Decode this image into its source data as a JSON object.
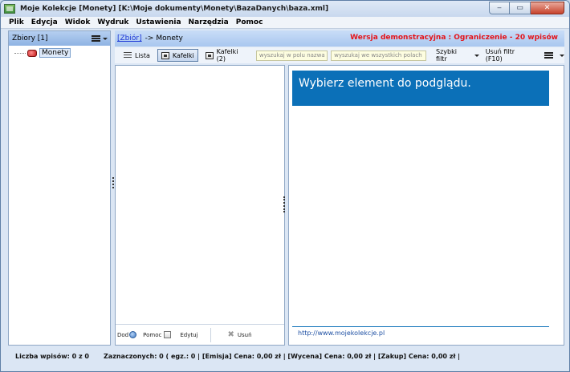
{
  "window": {
    "title": "Moje Kolekcje [Monety] [K:\\Moje dokumenty\\Monety\\BazaDanych\\baza.xml]",
    "controls": {
      "minimize": "‒",
      "maximize": "▭",
      "close": "✕"
    }
  },
  "menu": {
    "items": [
      "Plik",
      "Edycja",
      "Widok",
      "Wydruk",
      "Ustawienia",
      "Narzędzia",
      "Pomoc"
    ]
  },
  "sidebar": {
    "header": "Zbiory [1]",
    "tree": [
      {
        "label": "Monety"
      }
    ]
  },
  "breadcrumb": {
    "link": "[Zbiór]",
    "separator": "->",
    "current": "Monety",
    "demo_notice": "Wersja demonstracyjna : Ograniczenie - 20 wpisów"
  },
  "toolbar": {
    "view_list": "Lista",
    "view_tiles": "Kafelki",
    "view_tiles2": "Kafelki (2)",
    "search_name_placeholder": "wyszukaj w polu nazwa",
    "search_all_placeholder": "wyszukaj we wszystkich polach",
    "quick_filter": "Szybki filtr",
    "remove_filter": "Usuń filtr (F10)"
  },
  "list_footer": {
    "add": "Dod",
    "help": "Pomoc",
    "edit": "Edytuj",
    "delete": "Usuń"
  },
  "preview": {
    "heading": "Wybierz element do podglądu.",
    "link": "http://www.mojekolekcje.pl"
  },
  "status": {
    "entries": "Liczba wpisów: 0 z 0",
    "selected": "Zaznaczonych: 0 (  egz.: 0  |  [Emisja] Cena: 0,00 zł  |  [Wycena] Cena: 0,00 zł  |  [Zakup] Cena: 0,00 zł  |"
  },
  "colors": {
    "accent": "#0b70b8",
    "demo_red": "#e4141a",
    "link_blue": "#1a35d6"
  }
}
